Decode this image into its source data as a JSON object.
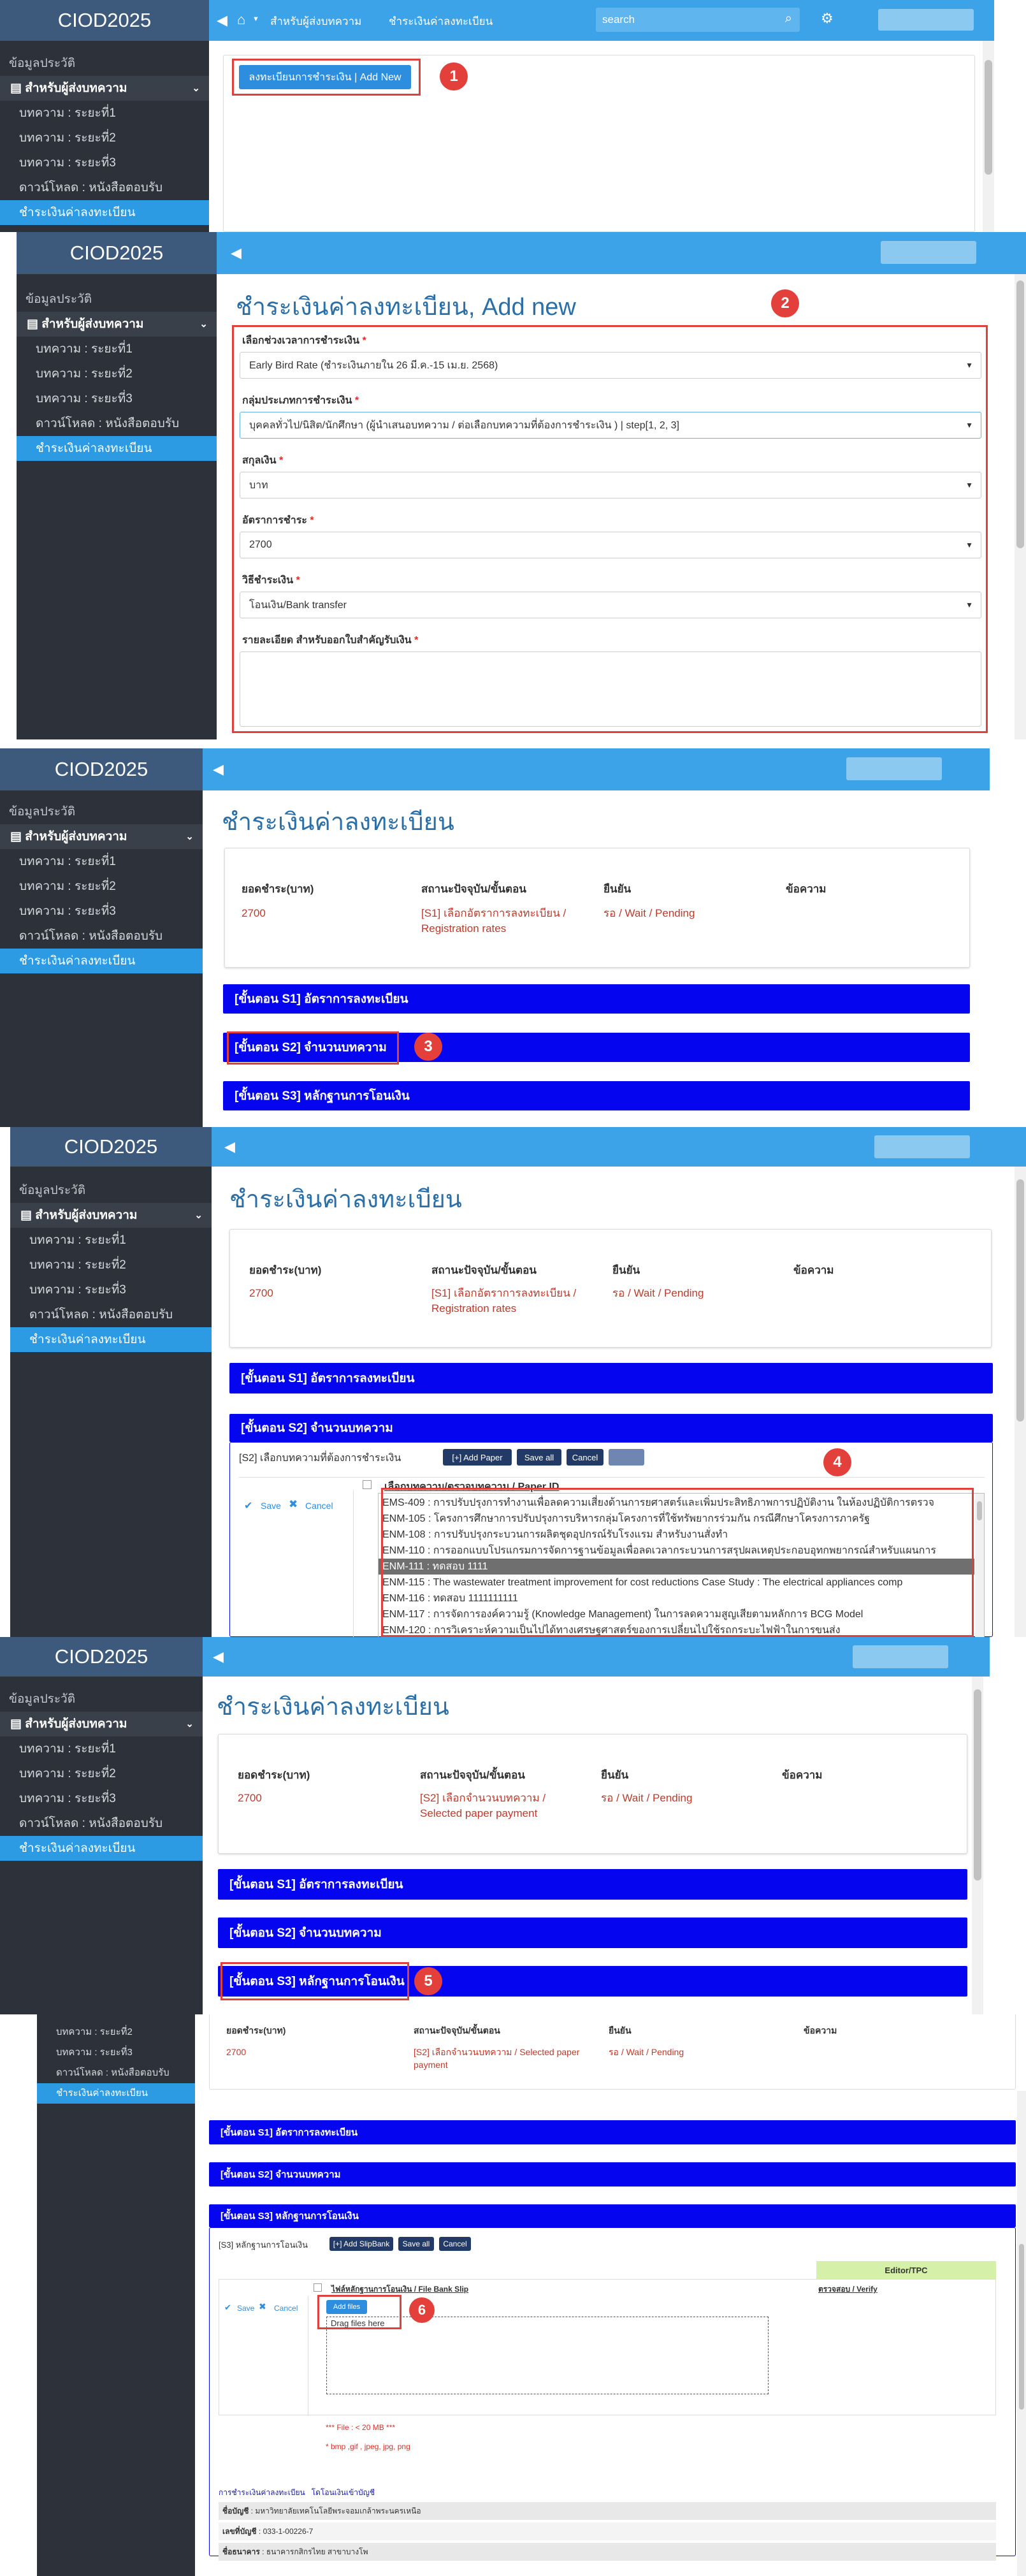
{
  "app": {
    "brand": "CIOD2025",
    "search_placeholder": "search"
  },
  "icons": {
    "collapse": "chevron-left-icon",
    "home": "home-icon",
    "search": "search-icon",
    "gear": "gear-icon",
    "chevron_down": "chevron-down-icon",
    "book": "book-icon"
  },
  "colors": {
    "sidebar": "#2c313a",
    "brand_bg": "#3d5a7c",
    "topbar": "#3da3e8",
    "step_bar": "#0505f0",
    "active_menu": "#2d9be3",
    "title": "#2a6fa8",
    "annotation": "#e4403b",
    "status_red": "#c0392b"
  },
  "topbar": {
    "crumb1": "สำหรับผู้ส่งบทความ",
    "crumb2": "ชำระเงินค่าลงทะเบียน"
  },
  "menu": {
    "profile": "ข้อมูลประวัติ",
    "group": "สำหรับผู้ส่งบทความ",
    "r1": "บทความ : ระยะที่1",
    "r2": "บทความ : ระยะที่2",
    "r3": "บทความ : ระยะที่3",
    "download": "ดาวน์โหลด : หนังสือตอบรับ",
    "payment": "ชำระเงินค่าลงทะเบียน"
  },
  "badges": [
    "1",
    "2",
    "3",
    "4",
    "5",
    "6"
  ],
  "s1": {
    "add_button": "ลงทะเบียนการชำระเงิน | Add New"
  },
  "s2": {
    "title": "ชำระเงินค่าลงทะเบียน, Add new",
    "period_label": "เลือกช่วงเวลาการชำระเงิน",
    "period_value": "Early Bird Rate (ชำระเงินภายใน 26 มี.ค.-15 เม.ย. 2568)",
    "type_label": "กลุ่มประเภทการชำระเงิน",
    "type_value": "บุคคลทั่วไป/นิสิต/นักศึกษา (ผู้นำเสนอบทความ / ต่อเลือกบทความที่ต้องการชำระเงิน ) | step[1, 2, 3]",
    "currency_label": "สกุลเงิน",
    "currency_value": "บาท",
    "rate_label": "อัตราการชำระ",
    "rate_value": "2700",
    "method_label": "วิธีชำระเงิน",
    "method_value": "โอนเงิน/Bank transfer",
    "detail_label": "รายละเอียด สำหรับออกใบสำคัญรับเงิน",
    "req": "*"
  },
  "pay": {
    "title": "ชำระเงินค่าลงทะเบียน",
    "h_amount": "ยอดชำระ(บาท)",
    "h_status": "สถานะปัจจุบัน/ขั้นตอน",
    "h_confirm": "ยืนยัน",
    "h_message": "ข้อความ",
    "amount": "2700",
    "status_s1": "[S1] เลือกอัตราการลงทะเบียน / Registration rates",
    "status_s2": "[S2] เลือกจำนวนบทความ / Selected paper payment",
    "confirm": "รอ / Wait / Pending",
    "step1": "[ขั้นตอน S1] อัตราการลงทะเบียน",
    "step2": "[ขั้นตอน S2] จำนวนบทความ",
    "step3": "[ขั้นตอน S3] หลักฐานการโอนเงิน"
  },
  "s4": {
    "s2_label": "[S2] เลือกบทความที่ต้องการชำระเงิน",
    "add_paper": "[+] Add Paper",
    "save_all": "Save all",
    "cancel": "Cancel",
    "save": "Save",
    "cancel2": "Cancel",
    "col_header": "เลือกบทความ/ตรวจบทความ / Paper ID",
    "papers": [
      "EMS-409 : การปรับปรุงการทำงานเพื่อลดความเสี่ยงด้านการยศาสตร์และเพิ่มประสิทธิภาพการปฏิบัติงาน ในห้องปฏิบัติการตรวจ",
      "ENM-105 : โครงการศึกษาการปรับปรุงการบริหารกลุ่มโครงการที่ใช้ทรัพยากรร่วมกัน กรณีศึกษาโครงการภาครัฐ",
      "ENM-108 : การปรับปรุงกระบวนการผลิตชุดอุปกรณ์รับโรงแรม สำหรับงานสั่งทำ",
      "ENM-110 : การออกแบบโปรแกรมการจัดการฐานข้อมูลเพื่อลดเวลากระบวนการสรุปผลเหตุประกอบอุทกพยากรณ์สำหรับแผนการ",
      "ENM-111 : ทดสอบ 1111",
      "ENM-115 : The wastewater treatment improvement for cost reductions Case Study : The electrical appliances comp",
      "ENM-116 : ทดสอบ 1111111111",
      "ENM-117 : การจัดการองค์ความรู้ (Knowledge Management) ในการลดความสูญเสียตามหลักการ BCG Model",
      "ENM-120 : การวิเคราะห์ความเป็นไปได้ทางเศรษฐศาสตร์ของการเปลี่ยนไปใช้รถกระบะไฟฟ้าในการขนส่ง"
    ]
  },
  "s6": {
    "s3_label": "[S3] หลักฐานการโอนเงิน",
    "add_slip": "[+] Add SlipBank",
    "save_all": "Save all",
    "cancel": "Cancel",
    "editor_header": "Editor/TPC",
    "col_file": "ไฟล์หลักฐานการโอนเงิน / File Bank Slip",
    "col_verify": "ตรวจสอบ / Verify",
    "save": "Save",
    "cancel2": "Cancel",
    "add_files": "Add files",
    "drag": "Drag files here",
    "file_note": "*** File : < 20 MB ***",
    "file_types": "* bmp ,gif , jpeg, jpg, png",
    "bank_link1": "การชำระเงินค่าลงทะเบียน",
    "bank_link2": "โดโอนเงินเข้าบัญชี",
    "acct_name_label": "ชื่อบัญชี",
    "acct_name": "มหาวิทยาลัยเทคโนโลยีพระจอมเกล้าพระนครเหนือ",
    "acct_no_label": "เลขที่บัญชี",
    "acct_no": "033-1-00226-7",
    "bank_label": "ชื่อธนาคาร",
    "bank": "ธนาคารกสิกรไทย สาขาบางโพ"
  }
}
